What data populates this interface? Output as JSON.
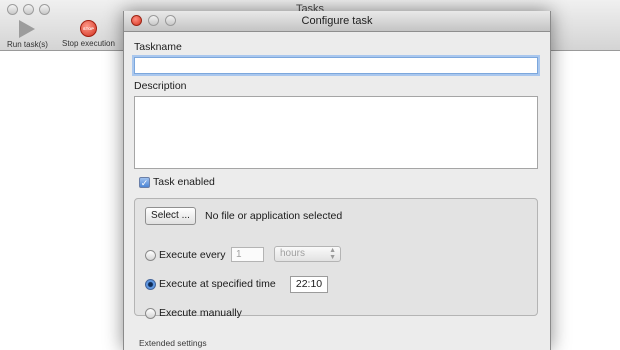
{
  "app": {
    "title": "Tasks",
    "toolbar": {
      "run_label": "Run task(s)",
      "stop_label": "Stop execution",
      "stop_icon_text": "STOP"
    }
  },
  "dialog": {
    "title": "Configure task",
    "taskname_label": "Taskname",
    "taskname_value": "",
    "description_label": "Description",
    "description_value": "",
    "task_enabled_label": "Task enabled",
    "task_enabled_checked": true,
    "select_button_label": "Select ...",
    "file_status": "No file or application selected",
    "schedule": {
      "execute_every_label": "Execute every",
      "interval_value": "1",
      "interval_unit": "hours",
      "execute_at_time_label": "Execute at specified time",
      "time_value": "22:10",
      "execute_manually_label": "Execute manually",
      "selected": "execute_at_time"
    },
    "extended_settings_label": "Extended settings"
  },
  "colors": {
    "focus_ring": "#a9c7ee",
    "radio_selected": "#5f98e3",
    "close_button": "#d5341f"
  }
}
